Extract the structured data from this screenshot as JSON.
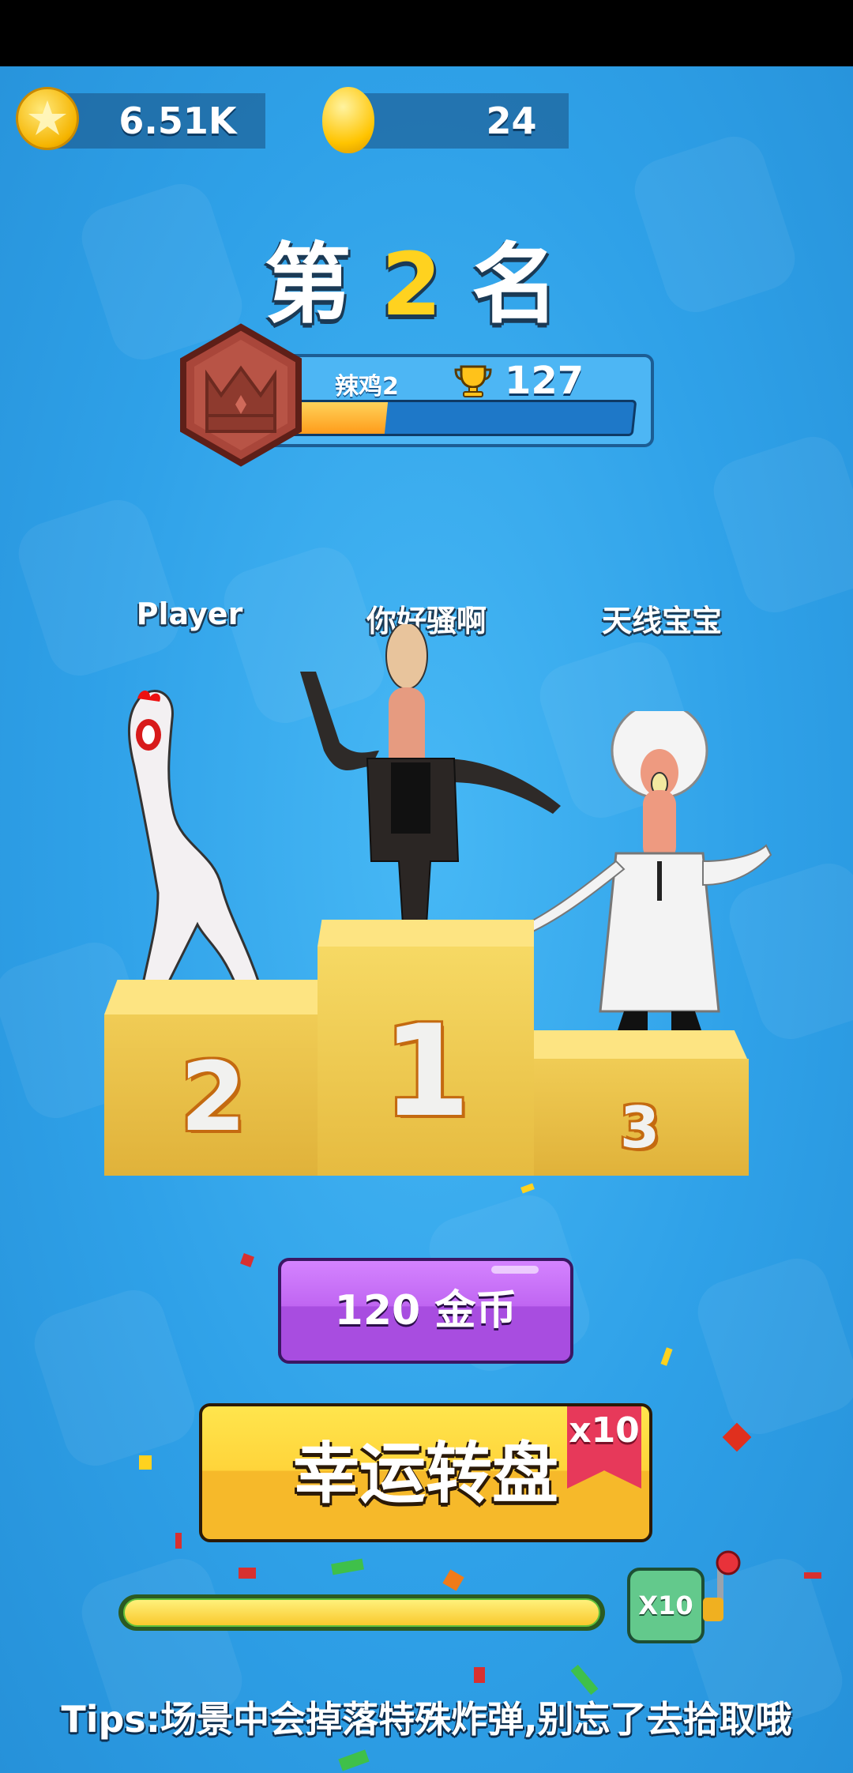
{
  "currency": {
    "gold_amount": "6.51K",
    "egg_amount": "24"
  },
  "result": {
    "title_left": "第",
    "rank_number": "2",
    "title_right": "名"
  },
  "level": {
    "name": "辣鸡2",
    "trophies": "127",
    "progress": 0.3
  },
  "podium": {
    "places": [
      {
        "name": "Player",
        "rank_label": "2"
      },
      {
        "name": "你好骚啊",
        "rank_label": "1"
      },
      {
        "name": "天线宝宝",
        "rank_label": "3"
      }
    ]
  },
  "reward": {
    "coins_label": "120  金币",
    "wheel_label": "幸运转盘",
    "wheel_multiplier": "x10",
    "spin_multiplier": "X10",
    "spin_progress": 1.0
  },
  "tips": "Tips:场景中会掉落特殊炸弹,别忘了去拾取哦",
  "colors": {
    "background": "#2e9fe6",
    "podium": "#e0b23a",
    "coins_button": "#c066f2",
    "wheel_button": "#ffd43a",
    "ribbon": "#e7395a"
  }
}
